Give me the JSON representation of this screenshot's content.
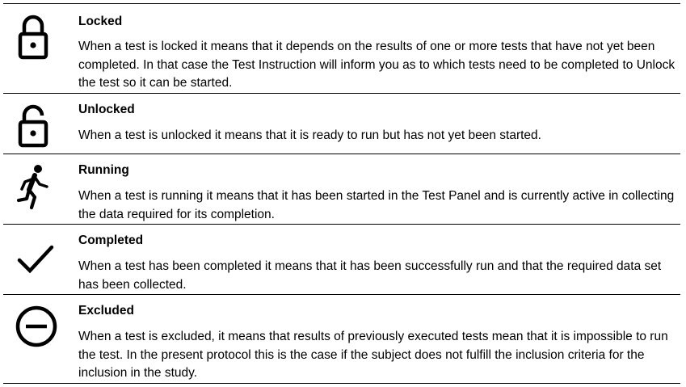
{
  "statuses": [
    {
      "icon": "lock-closed-icon",
      "title": "Locked",
      "description": "When a test is locked it means that it depends on the results of one or more tests that have not yet been completed. In that case the Test Instruction will inform you as to which tests need to be completed to Unlock the test so it can be started."
    },
    {
      "icon": "lock-open-icon",
      "title": "Unlocked",
      "description": "When a test is unlocked it means that it is ready to run but has not yet been started."
    },
    {
      "icon": "running-person-icon",
      "title": "Running",
      "description": "When a test is running it means that it has been started in the Test Panel and is currently active in collecting the data required for its completion."
    },
    {
      "icon": "checkmark-icon",
      "title": "Completed",
      "description": "When a test has been completed it means that it has been successfully run and that the required data set has been collected."
    },
    {
      "icon": "minus-circle-icon",
      "title": "Excluded",
      "description": "When a test is excluded, it means that results of previously executed tests mean that it is impossible to run the test. In the present protocol this is the case if the subject does not fulfill the inclusion criteria for the inclusion in the study."
    }
  ]
}
